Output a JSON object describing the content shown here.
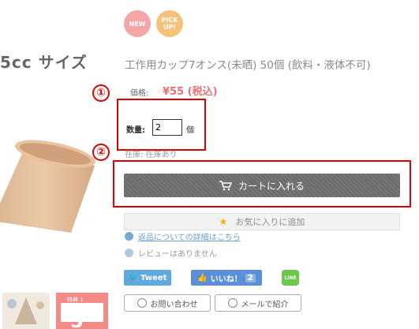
{
  "left": {
    "title": "5cc サイズ",
    "thumb2_top": "特典 1",
    "thumb2_number": "5"
  },
  "badges": {
    "new": "NEW",
    "pick_up": "PICK UP!"
  },
  "product": {
    "name": "工作用カップ7オンス(未晒) 50個 (飲料・液体不可)",
    "price_label": "価格:",
    "price_value": "¥55 (税込)",
    "quantity_label": "数量:",
    "quantity_value": "2",
    "quantity_unit": "個",
    "stock_text": "在庫: 在庫あり"
  },
  "markers": {
    "one": "①",
    "two": "②"
  },
  "actions": {
    "cart_label": "カートに入れる",
    "favorite_label": "お気に入りに追加",
    "returns_link": "返品についての詳細はこちら",
    "review_text": "レビューはありません"
  },
  "social": {
    "tweet_label": "Tweet",
    "like_label": "いいね！",
    "like_count": "2",
    "line_label": "LINE"
  },
  "footer_buttons": {
    "contact_label": "お問い合わせ",
    "mail_label": "メールで紹介"
  },
  "colors": {
    "price": "#f07070",
    "annotation": "#e00000",
    "cart_button": "#707070",
    "link": "#6aa0d0"
  }
}
